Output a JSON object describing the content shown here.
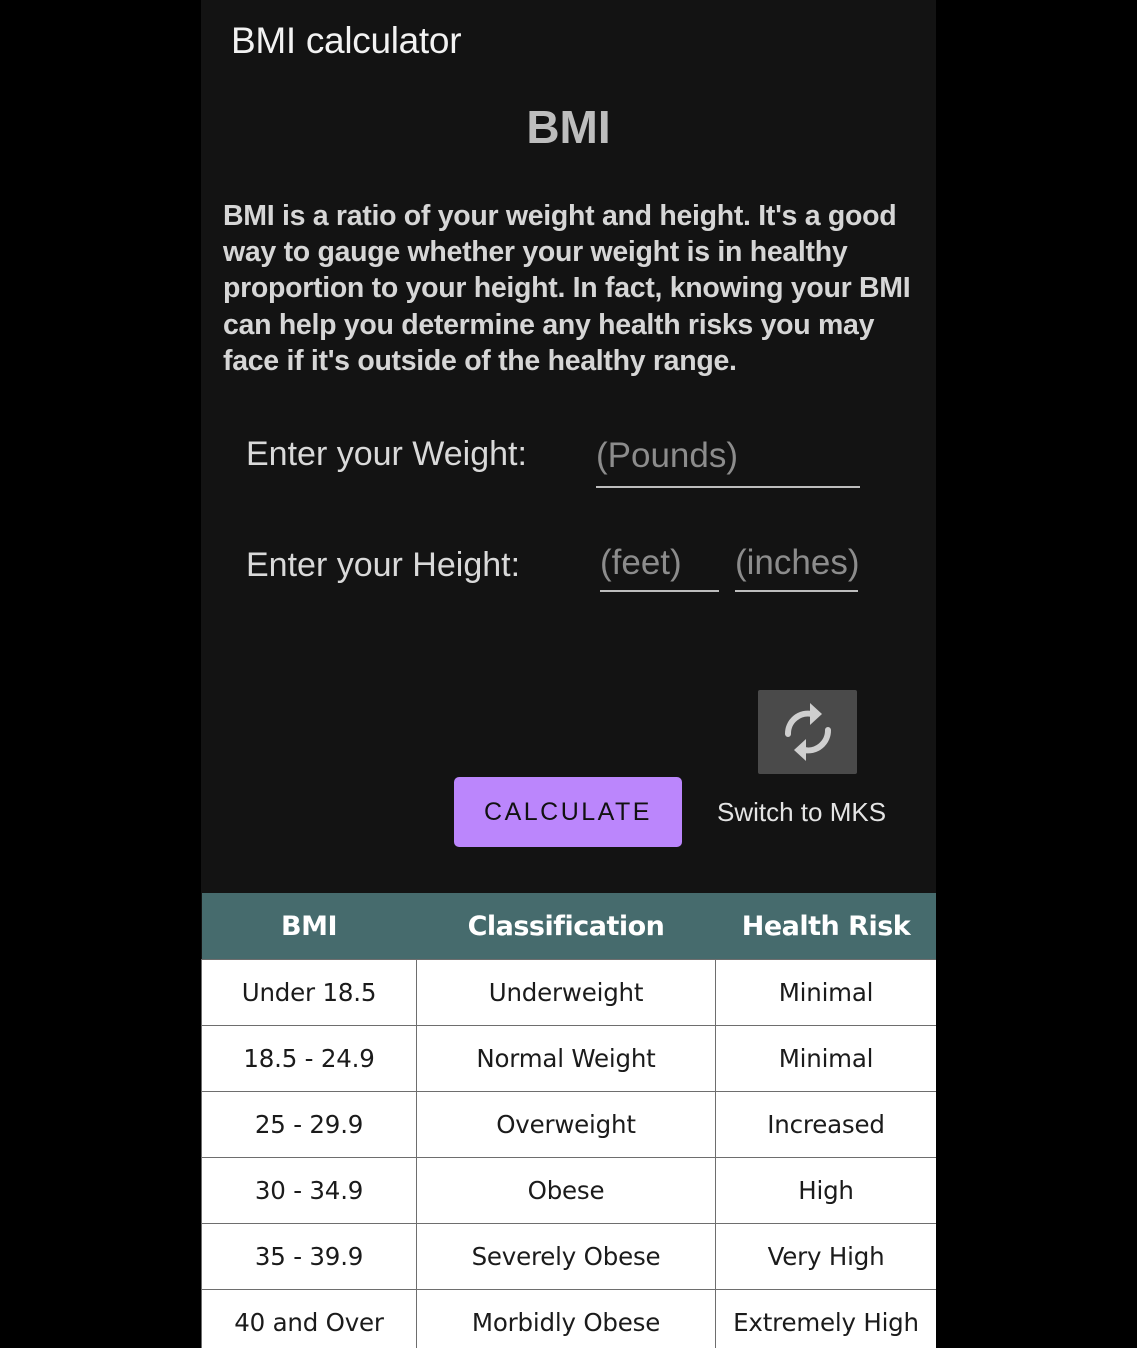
{
  "app": {
    "title": "BMI calculator"
  },
  "main": {
    "heading": "BMI",
    "description": "BMI is a ratio of your weight and height. It's a good way to gauge whether your weight is in healthy proportion to your height. In fact, knowing your BMI can help you determine any health risks you may face if it's outside of the healthy range."
  },
  "form": {
    "weight_label": "Enter your Weight:",
    "weight_placeholder": "(Pounds)",
    "height_label": "Enter your Height:",
    "feet_placeholder": "(feet)",
    "inches_placeholder": "(inches)"
  },
  "actions": {
    "calculate_label": "CALCULATE",
    "switch_label": "Switch to MKS",
    "switch_icon": "refresh-icon"
  },
  "table": {
    "headers": [
      "BMI",
      "Classification",
      "Health Risk"
    ],
    "rows": [
      [
        "Under 18.5",
        "Underweight",
        "Minimal"
      ],
      [
        "18.5 - 24.9",
        "Normal Weight",
        "Minimal"
      ],
      [
        "25 - 29.9",
        "Overweight",
        "Increased"
      ],
      [
        "30 - 34.9",
        "Obese",
        "High"
      ],
      [
        "35 - 39.9",
        "Severely Obese",
        "Very High"
      ],
      [
        "40 and Over",
        "Morbidly Obese",
        "Extremely High"
      ]
    ]
  },
  "colors": {
    "background": "#131313",
    "accent": "#bb86fc",
    "table_header": "#466b6d"
  }
}
